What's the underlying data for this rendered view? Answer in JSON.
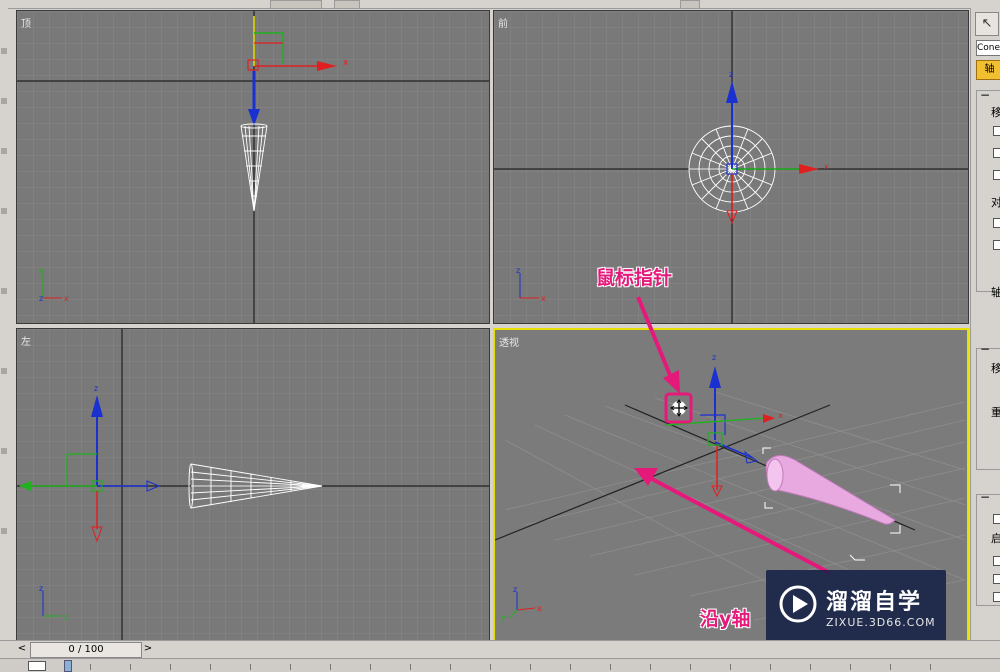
{
  "viewports": {
    "top": {
      "label": "顶"
    },
    "front": {
      "label": "前"
    },
    "left": {
      "label": "左"
    },
    "perspective": {
      "label": "透视"
    }
  },
  "axes": {
    "x": "x",
    "y": "y",
    "z": "z"
  },
  "command_panel": {
    "object_name": "Cone",
    "tab_label": "轴",
    "rollout_chars": [
      "移",
      "对",
      "轴",
      "移",
      "重",
      "启"
    ]
  },
  "timeline": {
    "frame_display": "0 / 100",
    "prev_arrow": "<",
    "next_arrow": ">"
  },
  "annotations": {
    "mouse_pointer": "鼠标指针",
    "drag_caption": "沿y轴"
  },
  "watermark": {
    "name": "溜溜自学",
    "url": "ZIXUE.3D66.COM"
  },
  "colors": {
    "active_border": "#e8e000",
    "annotation": "#e5197a",
    "viewport_bg": "#797979",
    "x_axis": "#e02020",
    "y_axis": "#20b020",
    "z_axis": "#1a30d0",
    "cone_selected": "#e8a8e0"
  }
}
